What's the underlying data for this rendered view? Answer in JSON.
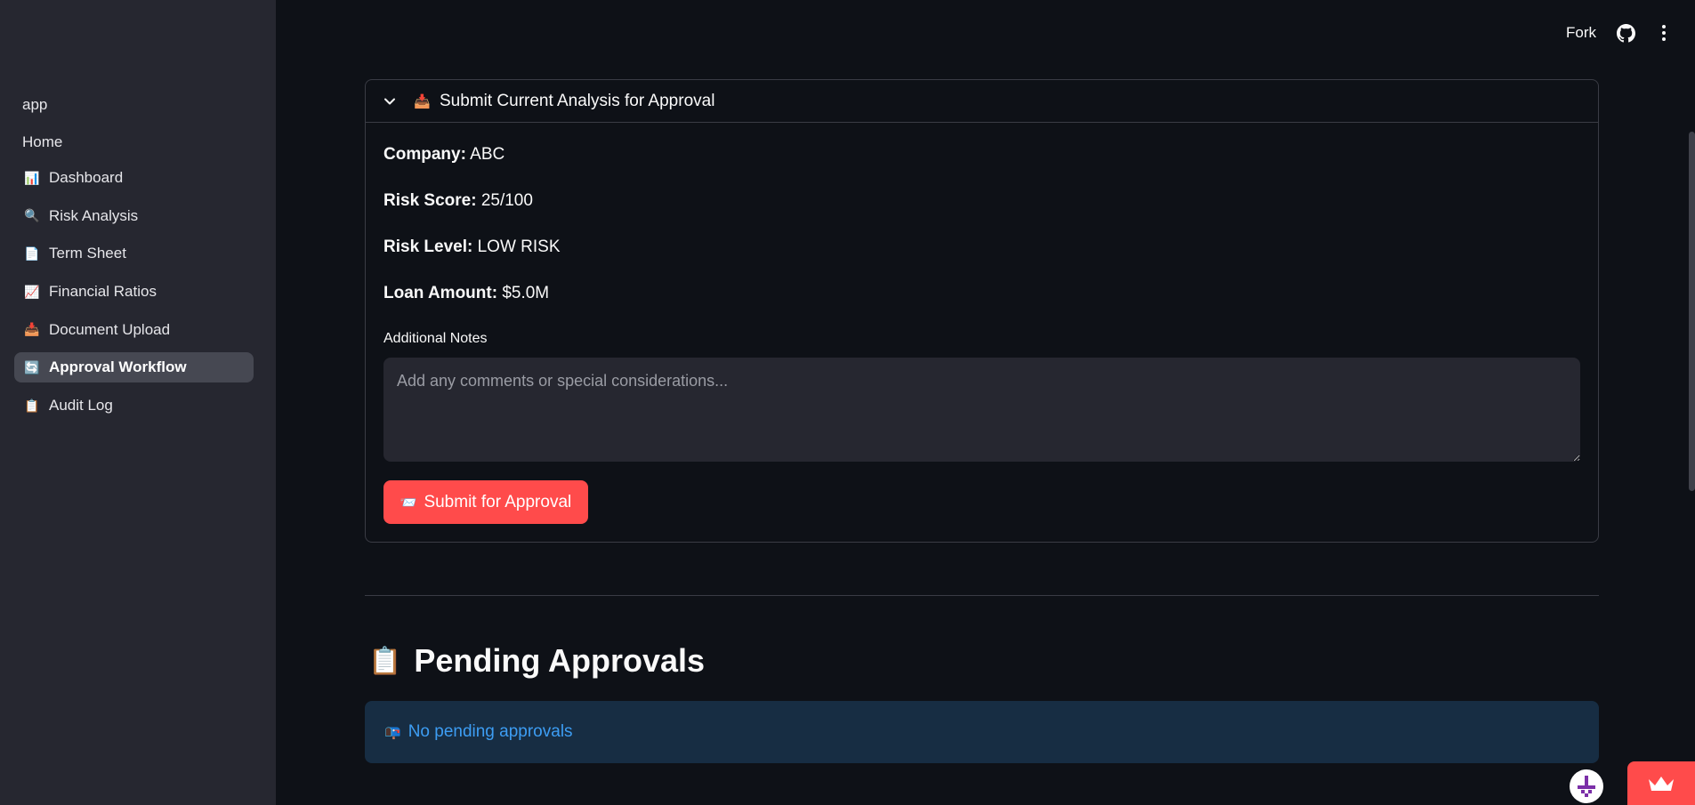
{
  "sidebar": {
    "app_label": "app",
    "home_label": "Home",
    "items": [
      {
        "label": "Dashboard",
        "icon": "bar-chart-icon",
        "glyph": "📊"
      },
      {
        "label": "Risk Analysis",
        "icon": "magnifier-icon",
        "glyph": "🔍"
      },
      {
        "label": "Term Sheet",
        "icon": "document-icon",
        "glyph": "📄"
      },
      {
        "label": "Financial Ratios",
        "icon": "chart-up-icon",
        "glyph": "📈"
      },
      {
        "label": "Document Upload",
        "icon": "inbox-icon",
        "glyph": "📥"
      },
      {
        "label": "Approval Workflow",
        "icon": "refresh-icon",
        "glyph": "🔄",
        "active": true
      },
      {
        "label": "Audit Log",
        "icon": "clipboard-icon",
        "glyph": "📋"
      }
    ]
  },
  "header": {
    "fork_label": "Fork",
    "github_icon": "github-icon",
    "menu_icon": "kebab-menu-icon"
  },
  "expander": {
    "title": "Submit Current Analysis for Approval",
    "title_glyph": "📥",
    "company_label": "Company:",
    "company_value": "ABC",
    "risk_score_label": "Risk Score:",
    "risk_score_value": "25/100",
    "risk_level_label": "Risk Level:",
    "risk_level_value": "LOW RISK",
    "loan_amount_label": "Loan Amount:",
    "loan_amount_value": "$5.0M",
    "notes_label": "Additional Notes",
    "notes_placeholder": "Add any comments or special considerations...",
    "notes_value": "",
    "submit_label": "Submit for Approval",
    "submit_glyph": "📨"
  },
  "pending": {
    "title": "Pending Approvals",
    "title_glyph": "📋",
    "empty_message": "No pending approvals",
    "empty_glyph": "📭"
  },
  "colors": {
    "background": "#0e1117",
    "sidebar": "#262730",
    "primary": "#ff4b4b",
    "info_bg": "#172d43",
    "info_text": "#3d9df3"
  }
}
